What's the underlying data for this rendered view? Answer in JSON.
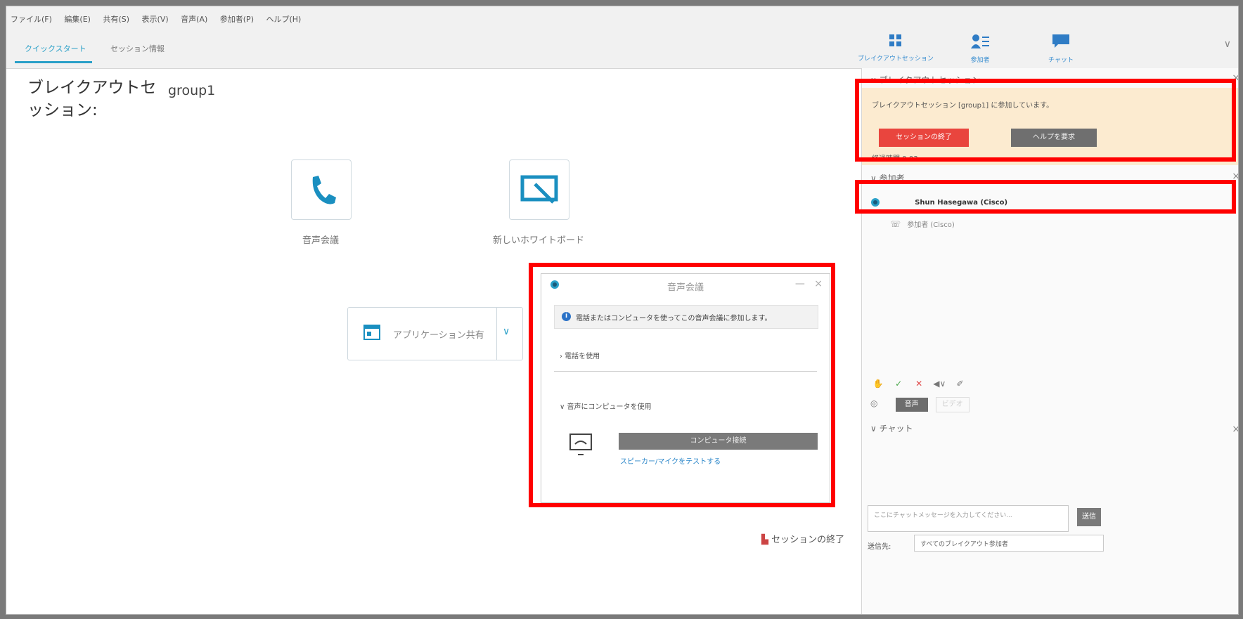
{
  "menu": {
    "items": [
      "ファイル(F)",
      "編集(E)",
      "共有(S)",
      "表示(V)",
      "音声(A)",
      "参加者(P)",
      "ヘルプ(H)"
    ]
  },
  "tabs": [
    {
      "label": "クイックスタート",
      "active": true
    },
    {
      "label": "セッション情報",
      "active": false
    }
  ],
  "toolbar": {
    "breakout": {
      "label": "ブレイクアウトセッション",
      "icon": "breakout-grid-icon"
    },
    "participants": {
      "label": "参加者",
      "icon": "participants-icon"
    },
    "chat": {
      "label": "チャット",
      "icon": "chat-bubble-icon"
    },
    "more": "∨"
  },
  "main": {
    "title": "ブレイクアウトセッション:",
    "group": "group1",
    "tiles": [
      {
        "label": "音声会議",
        "icon": "phone-icon"
      },
      {
        "label": "新しいホワイトボード",
        "icon": "whiteboard-icon"
      }
    ],
    "app_share": {
      "label": "アプリケーション共有",
      "dropdown": "∨"
    },
    "end_session": "セッションの終了"
  },
  "audio_dialog": {
    "title": "音声会議",
    "minimize": "—",
    "close": "×",
    "info": "電話またはコンピュータを使ってこの音声会議に参加します。",
    "phone_option": "› 電話を使用",
    "computer_option": "∨ 音声にコンピュータを使用",
    "connect_button": "コンピュータ接続",
    "test_link": "スピーカー/マイクをテストする"
  },
  "panel": {
    "breakout_header": "∨ ブレイクアウトセッション",
    "close": "×",
    "alert_message": "ブレイクアウトセッション [group1] に参加しています。",
    "end_button": "セッションの終了",
    "help_button": "ヘルプを要求",
    "elapsed": "経過時間 0:03",
    "participants_header": "∨ 参加者",
    "participants": [
      {
        "name": "Shun Hasegawa (Cisco)"
      },
      {
        "name": "参加者 (Cisco)"
      }
    ],
    "tools": [
      "✋",
      "✓",
      "✕",
      "◀∨",
      "✐"
    ],
    "voice_label": "音声",
    "video_label": "ビデオ",
    "chat_header": "∨ チャット",
    "chat_placeholder": "ここにチャットメッセージを入力してください...",
    "send_button": "送信",
    "to_label": "送信先:",
    "to_value": "すべてのブレイクアウト参加者"
  }
}
